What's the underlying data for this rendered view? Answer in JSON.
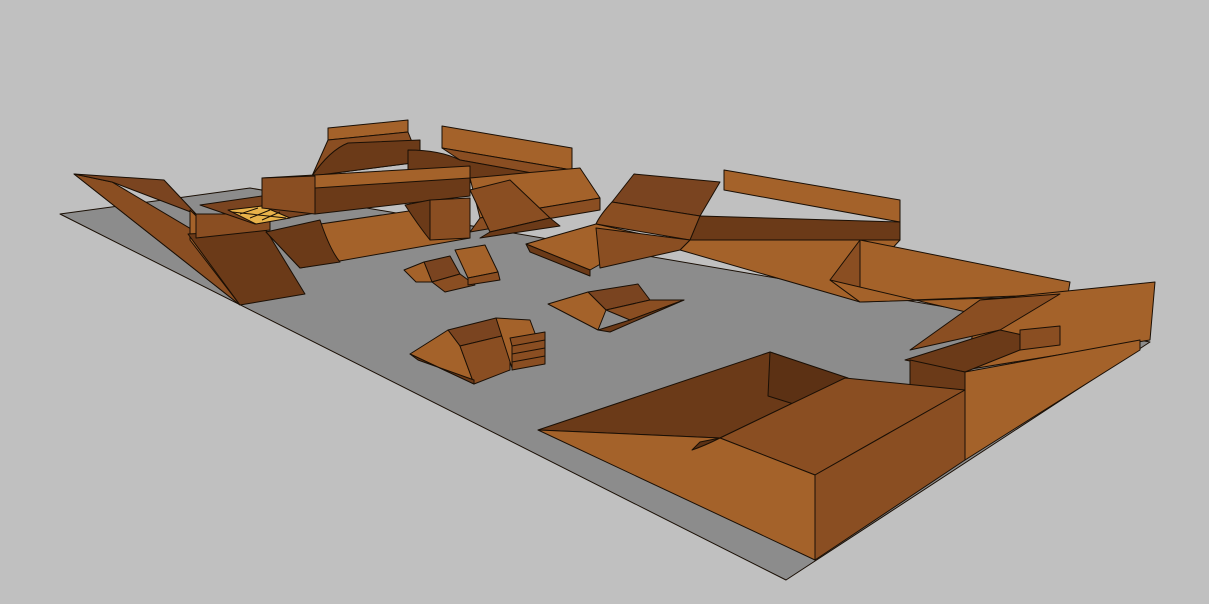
{
  "scene": {
    "colors": {
      "background": "#c0c0c0",
      "ground": "#8c8c8c",
      "ramp_light": "#a4622a",
      "ramp_mid": "#8a4e22",
      "ramp_dark": "#6b3a18",
      "ramp_top": "#7a4420",
      "edge": "#1a0f05"
    }
  }
}
